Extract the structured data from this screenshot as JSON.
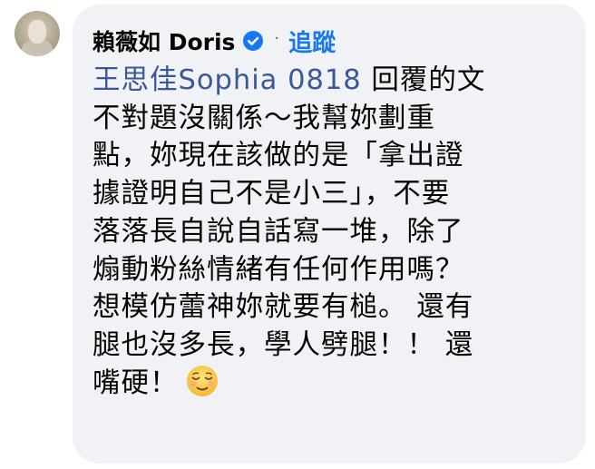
{
  "comment": {
    "author": "賴薇如 Doris",
    "separator": "·",
    "follow_label": "追蹤",
    "mention": "王思佳Sophia 0818",
    "lines": [
      " 回覆的文",
      "不對題沒關係～我幫妳劃重",
      "點，妳現在該做的是「拿出證",
      "據證明自己不是小三」，不要",
      "落落長自說自話寫一堆，除了",
      "煽動粉絲情緒有任何作用嗎？",
      "想模仿蕾神妳就要有槌。 還有",
      "腿也沒多長，學人劈腿！！ 還",
      "嘴硬！"
    ],
    "emoji": "relieved-face",
    "colors": {
      "bubble": "#f0f2f5",
      "link": "#1877f2",
      "mention": "#385898",
      "text": "#050505"
    }
  }
}
